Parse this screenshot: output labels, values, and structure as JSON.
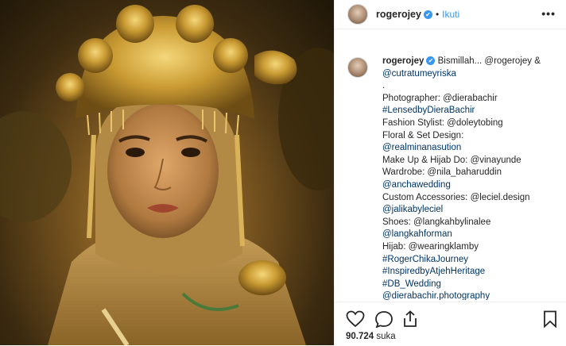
{
  "post": {
    "username": "rogerojey",
    "verified_mark": "✔",
    "separator": "•",
    "follow_label": "Ikuti",
    "more_label": "•••",
    "likes_count": "90.724",
    "likes_suffix": "suka"
  },
  "caption": {
    "username": "rogerojey",
    "lines": [
      "Bismillah... @rogerojey &",
      "@cutratumeyriska",
      ".",
      "Photographer: @dierabachir",
      "#LensedbyDieraBachir",
      "Fashion Stylist: @doleytobing",
      "Floral & Set Design:",
      "@realminanasution",
      "Make Up & Hijab Do: @vinayunde",
      "Wardrobe: @nila_baharuddin",
      "@anchawedding",
      "Custom Accessories: @leciel.design",
      "@jalikabyleciel",
      "Shoes: @langkahbylinalee",
      "@langkahforman",
      "Hijab: @wearingklamby",
      "#RogerChikaJourney",
      "#InspiredbyAtjehHeritage",
      "#DB_Wedding",
      "@dierabachir.photography"
    ]
  },
  "icons": {
    "like": "heart-icon",
    "comment": "comment-icon",
    "share": "share-icon",
    "save": "bookmark-icon",
    "verified": "verified-badge-icon",
    "more": "more-options-icon"
  },
  "colors": {
    "link": "#003569",
    "follow": "#3897f0",
    "verified": "#3897f0",
    "text": "#262626",
    "border": "#efefef"
  }
}
